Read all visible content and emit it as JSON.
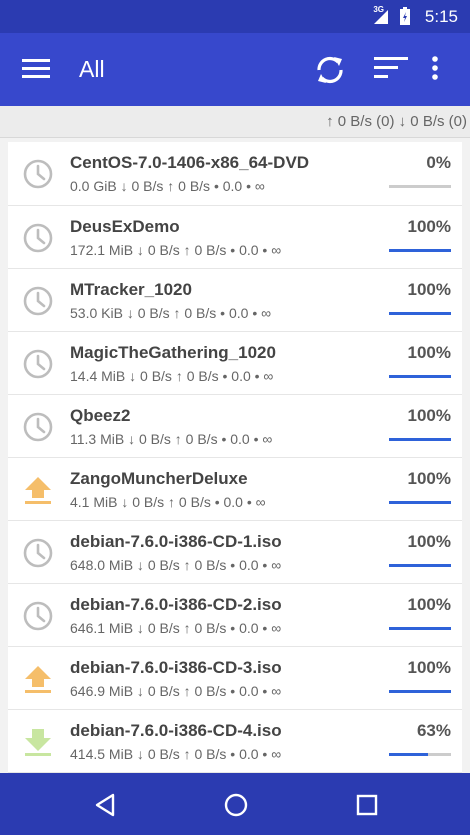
{
  "status_bar": {
    "network": "3G",
    "time": "5:15"
  },
  "app_bar": {
    "title": "All",
    "icons": [
      "hamburger-menu-icon",
      "refresh-icon",
      "sort-icon",
      "more-vert-icon"
    ]
  },
  "speed_summary": "↑ 0 B/s (0) ↓ 0 B/s (0)",
  "colors": {
    "status_bar": "#2b3bb1",
    "app_bar": "#3748cc",
    "progress": "#2e62d9",
    "seeding_icon": "#f5be6a",
    "downloading_icon": "#c8e6a0",
    "paused_icon": "#bdbdbd"
  },
  "torrents": [
    {
      "name": "CentOS-7.0-1406-x86_64-DVD",
      "stats": "0.0 GiB ↓ 0 B/s ↑ 0 B/s • 0.0 • ∞",
      "percent_label": "0%",
      "progress": 0,
      "state_icon": "clock-icon"
    },
    {
      "name": "DeusExDemo",
      "stats": "172.1 MiB ↓ 0 B/s ↑ 0 B/s • 0.0 • ∞",
      "percent_label": "100%",
      "progress": 100,
      "state_icon": "clock-icon"
    },
    {
      "name": "MTracker_1020",
      "stats": "53.0 KiB ↓ 0 B/s ↑ 0 B/s • 0.0 • ∞",
      "percent_label": "100%",
      "progress": 100,
      "state_icon": "clock-icon"
    },
    {
      "name": "MagicTheGathering_1020",
      "stats": "14.4 MiB ↓ 0 B/s ↑ 0 B/s • 0.0 • ∞",
      "percent_label": "100%",
      "progress": 100,
      "state_icon": "clock-icon"
    },
    {
      "name": "Qbeez2",
      "stats": "11.3 MiB ↓ 0 B/s ↑ 0 B/s • 0.0 • ∞",
      "percent_label": "100%",
      "progress": 100,
      "state_icon": "clock-icon"
    },
    {
      "name": "ZangoMuncherDeluxe",
      "stats": "4.1 MiB ↓ 0 B/s ↑ 0 B/s • 0.0 • ∞",
      "percent_label": "100%",
      "progress": 100,
      "state_icon": "upload-icon"
    },
    {
      "name": "debian-7.6.0-i386-CD-1.iso",
      "stats": "648.0 MiB ↓ 0 B/s ↑ 0 B/s • 0.0 • ∞",
      "percent_label": "100%",
      "progress": 100,
      "state_icon": "clock-icon"
    },
    {
      "name": "debian-7.6.0-i386-CD-2.iso",
      "stats": "646.1 MiB ↓ 0 B/s ↑ 0 B/s • 0.0 • ∞",
      "percent_label": "100%",
      "progress": 100,
      "state_icon": "clock-icon"
    },
    {
      "name": "debian-7.6.0-i386-CD-3.iso",
      "stats": "646.9 MiB ↓ 0 B/s ↑ 0 B/s • 0.0 • ∞",
      "percent_label": "100%",
      "progress": 100,
      "state_icon": "upload-icon"
    },
    {
      "name": "debian-7.6.0-i386-CD-4.iso",
      "stats": "414.5 MiB ↓ 0 B/s ↑ 0 B/s • 0.0 • ∞",
      "percent_label": "63%",
      "progress": 63,
      "state_icon": "download-icon"
    }
  ],
  "nav_bar": {
    "icons": [
      "back-icon",
      "home-icon",
      "recents-icon"
    ]
  }
}
